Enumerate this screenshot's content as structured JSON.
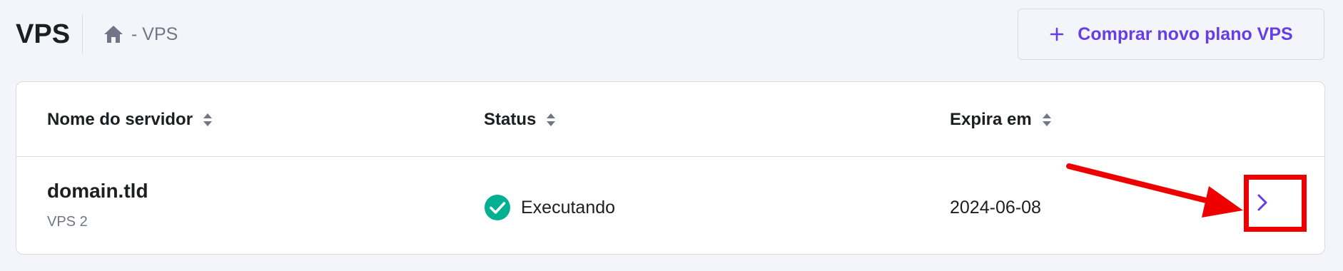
{
  "header": {
    "title": "VPS",
    "breadcrumb": "- VPS",
    "buy_button_label": "Comprar novo plano VPS"
  },
  "table": {
    "columns": [
      {
        "label": "Nome do servidor"
      },
      {
        "label": "Status"
      },
      {
        "label": "Expira em"
      }
    ],
    "rows": [
      {
        "name": "domain.tld",
        "plan": "VPS 2",
        "status": "Executando",
        "expires": "2024-06-08"
      }
    ]
  },
  "colors": {
    "accent": "#673de6",
    "success": "#00b090",
    "annotation": "#ee0000",
    "background": "#f4f4fb"
  },
  "icons": {
    "home": "home-icon",
    "plus": "plus-icon",
    "sort": "sort-icon",
    "status": "check-circle-icon",
    "row_action": "chevron-right-icon"
  }
}
